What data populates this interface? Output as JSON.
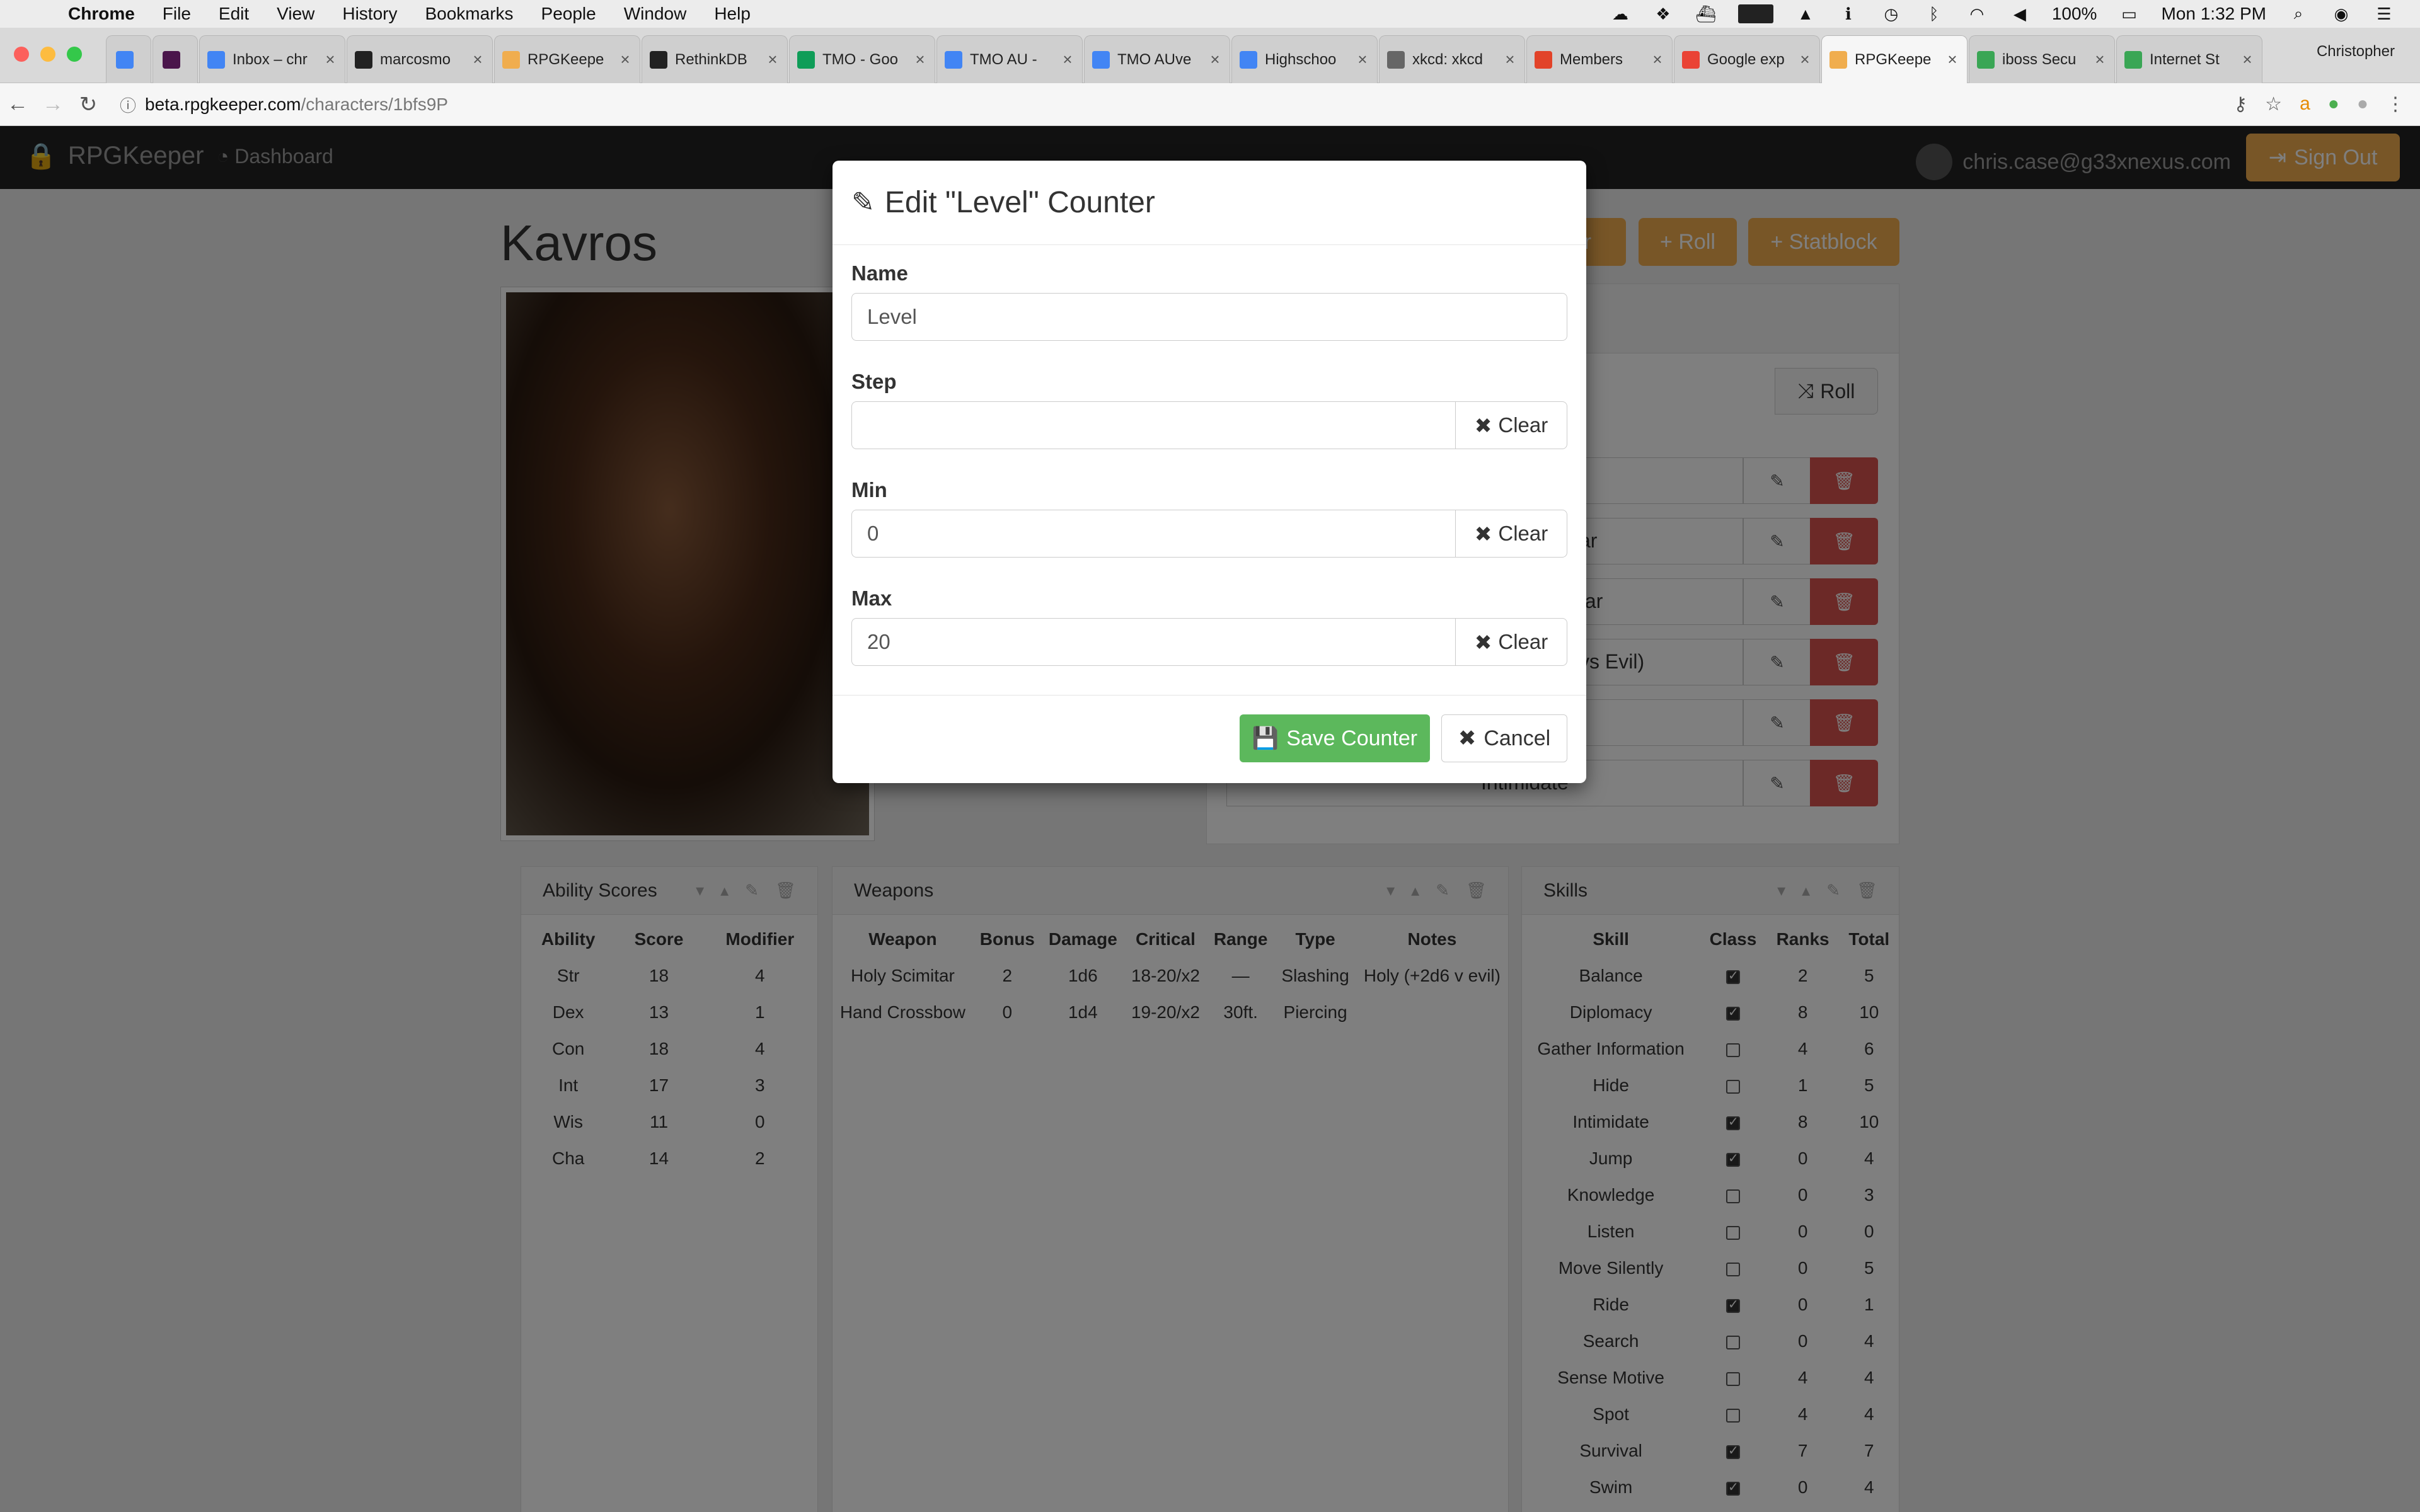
{
  "menubar": {
    "app": "Chrome",
    "items": [
      "File",
      "Edit",
      "View",
      "History",
      "Bookmarks",
      "People",
      "Window",
      "Help"
    ],
    "battery": "100%",
    "clock": "Mon 1:32 PM"
  },
  "browser": {
    "profile": "Christopher",
    "tabs": [
      {
        "title": "",
        "icon": "google-docs-icon"
      },
      {
        "title": "",
        "icon": "slack-icon"
      },
      {
        "title": "Inbox – chr",
        "icon": "inbox-icon"
      },
      {
        "title": "marcosmo",
        "icon": "github-icon"
      },
      {
        "title": "RPGKeepe",
        "icon": "rpgkeeper-icon"
      },
      {
        "title": "RethinkDB",
        "icon": "rethinkdb-icon"
      },
      {
        "title": "TMO - Goo",
        "icon": "google-drive-icon"
      },
      {
        "title": "TMO AU - ",
        "icon": "google-docs-icon"
      },
      {
        "title": "TMO AUve",
        "icon": "google-docs-icon"
      },
      {
        "title": "Highschoo",
        "icon": "google-docs-icon"
      },
      {
        "title": "xkcd: xkcd",
        "icon": "xkcd-icon"
      },
      {
        "title": "Members",
        "icon": "gitlab-icon"
      },
      {
        "title": "Google exp",
        "icon": "google-icon"
      },
      {
        "title": "RPGKeepe",
        "icon": "rpgkeeper-icon",
        "active": true
      },
      {
        "title": "iboss Secu",
        "icon": "iboss-icon"
      },
      {
        "title": "Internet St",
        "icon": "internet-icon"
      },
      {
        "title": "",
        "icon": "new-tab-icon"
      }
    ],
    "url_host": "beta.rpgkeeper.com",
    "url_path": "/characters/1bfs9P"
  },
  "app": {
    "brand": "RPGKeeper",
    "dashboard": "Dashboard",
    "user_email": "chris.case@g33xnexus.com",
    "sign_out": "Sign Out",
    "character_name": "Kavros",
    "buttons": {
      "partial": "er",
      "roll": "Roll",
      "statblock": "Statblock"
    },
    "roll_inline": "Roll",
    "row_fragments": [
      "ar",
      "tar",
      "vs Evil)",
      "",
      "Intimidate"
    ]
  },
  "ability_scores": {
    "title": "Ability Scores",
    "headers": [
      "Ability",
      "Score",
      "Modifier"
    ],
    "rows": [
      [
        "Str",
        "18",
        "4"
      ],
      [
        "Dex",
        "13",
        "1"
      ],
      [
        "Con",
        "18",
        "4"
      ],
      [
        "Int",
        "17",
        "3"
      ],
      [
        "Wis",
        "11",
        "0"
      ],
      [
        "Cha",
        "14",
        "2"
      ]
    ]
  },
  "weapons": {
    "title": "Weapons",
    "headers": [
      "Weapon",
      "Bonus",
      "Damage",
      "Critical",
      "Range",
      "Type",
      "Notes"
    ],
    "rows": [
      [
        "Holy Scimitar",
        "2",
        "1d6",
        "18-20/x2",
        "—",
        "Slashing",
        "Holy (+2d6 v evil)"
      ],
      [
        "Hand Crossbow",
        "0",
        "1d4",
        "19-20/x2",
        "30ft.",
        "Piercing",
        ""
      ]
    ]
  },
  "skills": {
    "title": "Skills",
    "headers": [
      "Skill",
      "Class",
      "Ranks",
      "Total"
    ],
    "rows": [
      {
        "skill": "Balance",
        "class": true,
        "ranks": "2",
        "total": "5"
      },
      {
        "skill": "Diplomacy",
        "class": true,
        "ranks": "8",
        "total": "10"
      },
      {
        "skill": "Gather Information",
        "class": false,
        "ranks": "4",
        "total": "6"
      },
      {
        "skill": "Hide",
        "class": false,
        "ranks": "1",
        "total": "5"
      },
      {
        "skill": "Intimidate",
        "class": true,
        "ranks": "8",
        "total": "10"
      },
      {
        "skill": "Jump",
        "class": true,
        "ranks": "0",
        "total": "4"
      },
      {
        "skill": "Knowledge",
        "class": false,
        "ranks": "0",
        "total": "3"
      },
      {
        "skill": "Listen",
        "class": false,
        "ranks": "0",
        "total": "0"
      },
      {
        "skill": "Move Silently",
        "class": false,
        "ranks": "0",
        "total": "5"
      },
      {
        "skill": "Ride",
        "class": true,
        "ranks": "0",
        "total": "1"
      },
      {
        "skill": "Search",
        "class": false,
        "ranks": "0",
        "total": "4"
      },
      {
        "skill": "Sense Motive",
        "class": false,
        "ranks": "4",
        "total": "4"
      },
      {
        "skill": "Spot",
        "class": false,
        "ranks": "4",
        "total": "4"
      },
      {
        "skill": "Survival",
        "class": true,
        "ranks": "7",
        "total": "7"
      },
      {
        "skill": "Swim",
        "class": true,
        "ranks": "0",
        "total": "4"
      }
    ]
  },
  "modal": {
    "title": "Edit \"Level\" Counter",
    "name_label": "Name",
    "name_value": "Level",
    "step_label": "Step",
    "step_value": "",
    "min_label": "Min",
    "min_value": "0",
    "max_label": "Max",
    "max_value": "20",
    "clear_label": "Clear",
    "save_label": "Save Counter",
    "cancel_label": "Cancel"
  },
  "colors": {
    "accent_orange": "#f0ad4e",
    "success_green": "#5cb85c",
    "danger_red": "#d9534f",
    "navbar": "#222222"
  }
}
